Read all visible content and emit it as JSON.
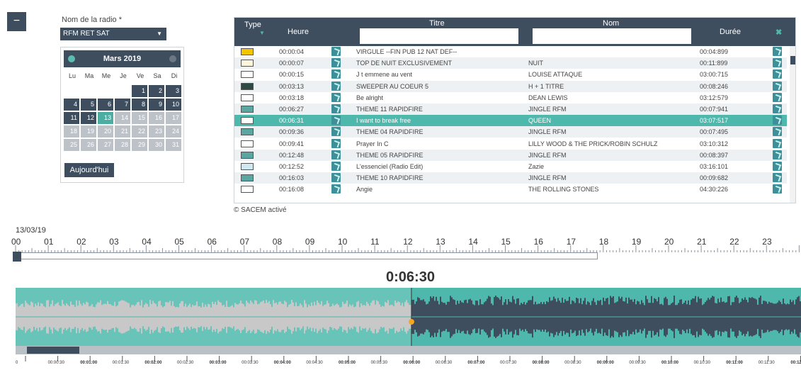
{
  "sidebar": {
    "collapse_icon": "minus-icon",
    "collapse_symbol": "−"
  },
  "radio": {
    "label": "Nom de la radio *",
    "selected": "RFM RET SAT"
  },
  "calendar": {
    "month": "Mars 2019",
    "dows": [
      "Lu",
      "Ma",
      "Me",
      "Je",
      "Ve",
      "Sa",
      "Di"
    ],
    "first_weekday": 4,
    "days_in_month": 31,
    "selected_day": 13,
    "last_enabled_day": 12,
    "today_label": "Aujourd'hui"
  },
  "table": {
    "headers": {
      "type": "Type",
      "heure": "Heure",
      "titre": "Titre",
      "nom": "Nom",
      "duree": "Durée",
      "clear": "✖"
    },
    "filters": {
      "titre": "",
      "nom": ""
    },
    "rows": [
      {
        "color": "#f5c400",
        "heure": "00:00:04",
        "titre": "VIRGULE --FIN PUB 12 NAT DEF--",
        "nom": "",
        "duree": "00:04:899"
      },
      {
        "color": "#fdf6dc",
        "heure": "00:00:07",
        "titre": "TOP DE NUIT EXCLUSIVEMENT",
        "nom": "NUIT",
        "duree": "00:11:899"
      },
      {
        "color": "#ffffff",
        "heure": "00:00:15",
        "titre": "J t emmene au vent",
        "nom": "LOUISE ATTAQUE",
        "duree": "03:00:715"
      },
      {
        "color": "#2f4a44",
        "heure": "00:03:13",
        "titre": "SWEEPER AU COEUR 5",
        "nom": "H + 1 TITRE",
        "duree": "00:08:246"
      },
      {
        "color": "#ffffff",
        "heure": "00:03:18",
        "titre": "Be alright",
        "nom": "DEAN LEWIS",
        "duree": "03:12:579"
      },
      {
        "color": "#5aa6a0",
        "heure": "00:06:27",
        "titre": "THEME 11 RAPIDFIRE",
        "nom": "JINGLE RFM",
        "duree": "00:07:941"
      },
      {
        "color": "#ffffff",
        "heure": "00:06:31",
        "titre": "I want to break free",
        "nom": "QUEEN",
        "duree": "03:07:517",
        "selected": true
      },
      {
        "color": "#5aa6a0",
        "heure": "00:09:36",
        "titre": "THEME 04 RAPIDFIRE",
        "nom": "JINGLE RFM",
        "duree": "00:07:495"
      },
      {
        "color": "#ffffff",
        "heure": "00:09:41",
        "titre": "Prayer In C",
        "nom": "LILLY WOOD & THE PRICK/ROBIN SCHULZ",
        "duree": "03:10:312"
      },
      {
        "color": "#5aa6a0",
        "heure": "00:12:48",
        "titre": "THEME 05 RAPIDFIRE",
        "nom": "JINGLE RFM",
        "duree": "00:08:397"
      },
      {
        "color": "#cfe8f2",
        "heure": "00:12:52",
        "titre": "L'essenciel (Radio Edit)",
        "nom": "Zazie",
        "duree": "03:16:101"
      },
      {
        "color": "#5aa6a0",
        "heure": "00:16:03",
        "titre": "THEME 10 RAPIDFIRE",
        "nom": "JINGLE RFM",
        "duree": "00:09:682"
      },
      {
        "color": "#ffffff",
        "heure": "00:16:08",
        "titre": "Angie",
        "nom": "THE ROLLING STONES",
        "duree": "04:30:226"
      }
    ]
  },
  "sacem": "© SACEM activé",
  "timeline": {
    "date": "13/03/19",
    "hours": [
      "00",
      "01",
      "02",
      "03",
      "04",
      "05",
      "06",
      "07",
      "08",
      "09",
      "10",
      "11",
      "12",
      "13",
      "14",
      "15",
      "16",
      "17",
      "18",
      "19",
      "20",
      "21",
      "22",
      "23"
    ],
    "current_time": "0:06:30",
    "playhead_fraction": 0.504,
    "ruler_labels": [
      "0",
      "00:00:30",
      "00:01:00",
      "00:01:30",
      "00:02:00",
      "00:02:30",
      "00:03:00",
      "00:03:30",
      "00:04:00",
      "00:04:30",
      "00:05:00",
      "00:05:30",
      "00:06:00",
      "00:06:30",
      "00:07:00",
      "00:07:30",
      "00:08:00",
      "00:08:30",
      "00:09:00",
      "00:09:30",
      "00:10:00",
      "00:10:30",
      "00:11:00",
      "00:11:30",
      "00:12:00"
    ]
  },
  "colors": {
    "accent": "#4eb8ad",
    "dark": "#3f4e5f",
    "played_wave": "#c8c8c8",
    "unplayed_wave": "#3f4e5f"
  }
}
